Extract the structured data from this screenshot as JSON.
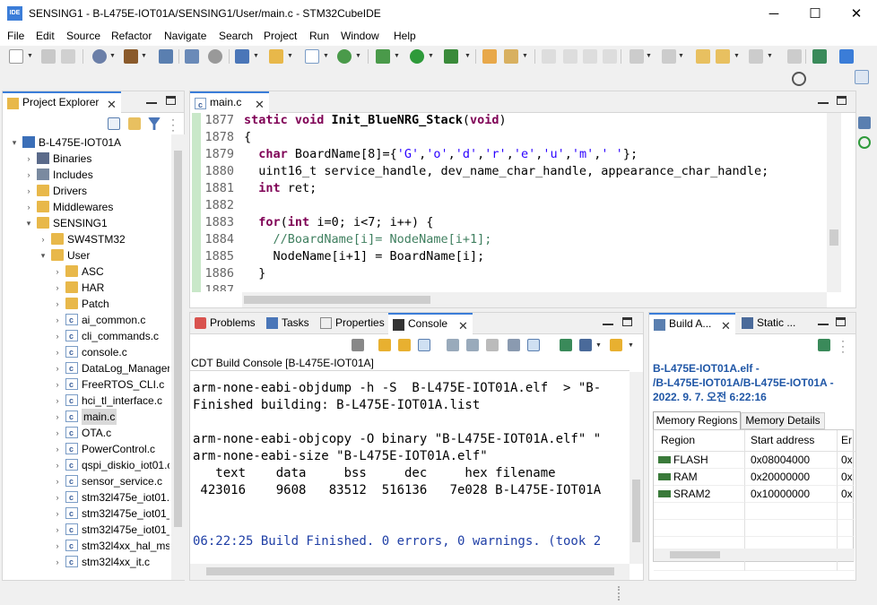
{
  "window": {
    "title": "SENSING1 - B-L475E-IOT01A/SENSING1/User/main.c - STM32CubeIDE",
    "icon_text": "IDE",
    "minimize": "─",
    "maximize": "☐",
    "close": "✕"
  },
  "menu": [
    "File",
    "Edit",
    "Source",
    "Refactor",
    "Navigate",
    "Search",
    "Project",
    "Run",
    "Window",
    "Help"
  ],
  "project_explorer": {
    "tab_label": "Project Explorer",
    "close": "✕",
    "items": [
      {
        "label": "B-L475E-IOT01A",
        "level": 0,
        "arrow": "▾",
        "icon": "project"
      },
      {
        "label": "Binaries",
        "level": 1,
        "arrow": "›",
        "icon": "binaries"
      },
      {
        "label": "Includes",
        "level": 1,
        "arrow": "›",
        "icon": "includes"
      },
      {
        "label": "Drivers",
        "level": 1,
        "arrow": "›",
        "icon": "folder"
      },
      {
        "label": "Middlewares",
        "level": 1,
        "arrow": "›",
        "icon": "folder"
      },
      {
        "label": "SENSING1",
        "level": 1,
        "arrow": "▾",
        "icon": "folder"
      },
      {
        "label": "SW4STM32",
        "level": 2,
        "arrow": "›",
        "icon": "folder"
      },
      {
        "label": "User",
        "level": 2,
        "arrow": "▾",
        "icon": "folder"
      },
      {
        "label": "ASC",
        "level": 3,
        "arrow": "›",
        "icon": "folder"
      },
      {
        "label": "HAR",
        "level": 3,
        "arrow": "›",
        "icon": "folder"
      },
      {
        "label": "Patch",
        "level": 3,
        "arrow": "›",
        "icon": "folder"
      },
      {
        "label": "ai_common.c",
        "level": 3,
        "arrow": "›",
        "icon": "cfile"
      },
      {
        "label": "cli_commands.c",
        "level": 3,
        "arrow": "›",
        "icon": "cfile"
      },
      {
        "label": "console.c",
        "level": 3,
        "arrow": "›",
        "icon": "cfile"
      },
      {
        "label": "DataLog_Manager.",
        "level": 3,
        "arrow": "›",
        "icon": "cfile"
      },
      {
        "label": "FreeRTOS_CLI.c",
        "level": 3,
        "arrow": "›",
        "icon": "cfile"
      },
      {
        "label": "hci_tl_interface.c",
        "level": 3,
        "arrow": "›",
        "icon": "cfile"
      },
      {
        "label": "main.c",
        "level": 3,
        "arrow": "›",
        "icon": "cfile",
        "selected": true
      },
      {
        "label": "OTA.c",
        "level": 3,
        "arrow": "›",
        "icon": "cfile"
      },
      {
        "label": "PowerControl.c",
        "level": 3,
        "arrow": "›",
        "icon": "cfile"
      },
      {
        "label": "qspi_diskio_iot01.c",
        "level": 3,
        "arrow": "›",
        "icon": "cfile"
      },
      {
        "label": "sensor_service.c",
        "level": 3,
        "arrow": "›",
        "icon": "cfile"
      },
      {
        "label": "stm32l475e_iot01.",
        "level": 3,
        "arrow": "›",
        "icon": "cfile"
      },
      {
        "label": "stm32l475e_iot01_",
        "level": 3,
        "arrow": "›",
        "icon": "cfile"
      },
      {
        "label": "stm32l475e_iot01_",
        "level": 3,
        "arrow": "›",
        "icon": "cfile"
      },
      {
        "label": "stm32l4xx_hal_ms",
        "level": 3,
        "arrow": "›",
        "icon": "cfile"
      },
      {
        "label": "stm32l4xx_it.c",
        "level": 3,
        "arrow": "›",
        "icon": "cfile"
      }
    ]
  },
  "editor": {
    "tab_label": "main.c",
    "close": "✕",
    "lines": [
      {
        "num": "1877",
        "segments": [
          {
            "t": "static void ",
            "c": "kw"
          },
          {
            "t": "Init_BlueNRG_Stack",
            "c": "fnb"
          },
          {
            "t": "(",
            "c": ""
          },
          {
            "t": "void",
            "c": "kw"
          },
          {
            "t": ")",
            "c": ""
          }
        ]
      },
      {
        "num": "1878",
        "segments": [
          {
            "t": "{",
            "c": ""
          }
        ]
      },
      {
        "num": "1879",
        "segments": [
          {
            "t": "  ",
            "c": ""
          },
          {
            "t": "char",
            "c": "kw"
          },
          {
            "t": " BoardName[8]={",
            "c": ""
          },
          {
            "t": "'G'",
            "c": "str"
          },
          {
            "t": ",",
            "c": ""
          },
          {
            "t": "'o'",
            "c": "str"
          },
          {
            "t": ",",
            "c": ""
          },
          {
            "t": "'d'",
            "c": "str"
          },
          {
            "t": ",",
            "c": ""
          },
          {
            "t": "'r'",
            "c": "str"
          },
          {
            "t": ",",
            "c": ""
          },
          {
            "t": "'e'",
            "c": "str"
          },
          {
            "t": ",",
            "c": ""
          },
          {
            "t": "'u'",
            "c": "str"
          },
          {
            "t": ",",
            "c": ""
          },
          {
            "t": "'m'",
            "c": "str"
          },
          {
            "t": ",",
            "c": ""
          },
          {
            "t": "' '",
            "c": "str"
          },
          {
            "t": "};",
            "c": ""
          }
        ]
      },
      {
        "num": "1880",
        "segments": [
          {
            "t": "  uint16_t service_handle, dev_name_char_handle, appearance_char_handle;",
            "c": ""
          }
        ]
      },
      {
        "num": "1881",
        "segments": [
          {
            "t": "  ",
            "c": ""
          },
          {
            "t": "int",
            "c": "kw"
          },
          {
            "t": " ret;",
            "c": ""
          }
        ]
      },
      {
        "num": "1882",
        "segments": [
          {
            "t": "",
            "c": ""
          }
        ]
      },
      {
        "num": "1883",
        "segments": [
          {
            "t": "  ",
            "c": ""
          },
          {
            "t": "for",
            "c": "kw"
          },
          {
            "t": "(",
            "c": ""
          },
          {
            "t": "int",
            "c": "kw"
          },
          {
            "t": " i=0; i<7; i++) {",
            "c": ""
          }
        ]
      },
      {
        "num": "1884",
        "segments": [
          {
            "t": "    //BoardName[i]= NodeName[i+1];",
            "c": "cm"
          }
        ]
      },
      {
        "num": "1885",
        "segments": [
          {
            "t": "    NodeName[i+1] = BoardName[i];",
            "c": ""
          }
        ]
      },
      {
        "num": "1886",
        "segments": [
          {
            "t": "  }",
            "c": ""
          }
        ]
      },
      {
        "num": "1887",
        "segments": [
          {
            "t": "",
            "c": ""
          }
        ]
      }
    ]
  },
  "console": {
    "tabs": [
      "Problems",
      "Tasks",
      "Properties",
      "Console"
    ],
    "close": "✕",
    "header": "CDT Build Console [B-L475E-IOT01A]",
    "lines": [
      {
        "text": "arm-none-eabi-objdump -h -S  B-L475E-IOT01A.elf  > \"B-",
        "c": ""
      },
      {
        "text": "Finished building: B-L475E-IOT01A.list",
        "c": ""
      },
      {
        "text": "",
        "c": ""
      },
      {
        "text": "arm-none-eabi-objcopy -O binary \"B-L475E-IOT01A.elf\" \"",
        "c": ""
      },
      {
        "text": "arm-none-eabi-size \"B-L475E-IOT01A.elf\"",
        "c": ""
      },
      {
        "text": "   text    data     bss     dec     hex filename",
        "c": ""
      },
      {
        "text": " 423016    9608   83512  516136   7e028 B-L475E-IOT01A",
        "c": ""
      },
      {
        "text": "",
        "c": ""
      },
      {
        "text": "",
        "c": ""
      },
      {
        "text": "06:22:25 Build Finished. 0 errors, 0 warnings. (took 2",
        "c": "blue"
      }
    ]
  },
  "build_analyzer": {
    "tabs": [
      "Build A...",
      "Static ..."
    ],
    "close": "✕",
    "title_line1": "B-L475E-IOT01A.elf -",
    "title_line2": "/B-L475E-IOT01A/B-L475E-IOT01A -",
    "title_line3": "2022. 9. 7. 오전 6:22:16",
    "subtabs": [
      "Memory Regions",
      "Memory Details"
    ],
    "columns": [
      "Region",
      "Start address",
      "Er"
    ],
    "rows": [
      {
        "region": "FLASH",
        "start": "0x08004000",
        "end": "0x"
      },
      {
        "region": "RAM",
        "start": "0x20000000",
        "end": "0x"
      },
      {
        "region": "SRAM2",
        "start": "0x10000000",
        "end": "0x"
      }
    ]
  }
}
